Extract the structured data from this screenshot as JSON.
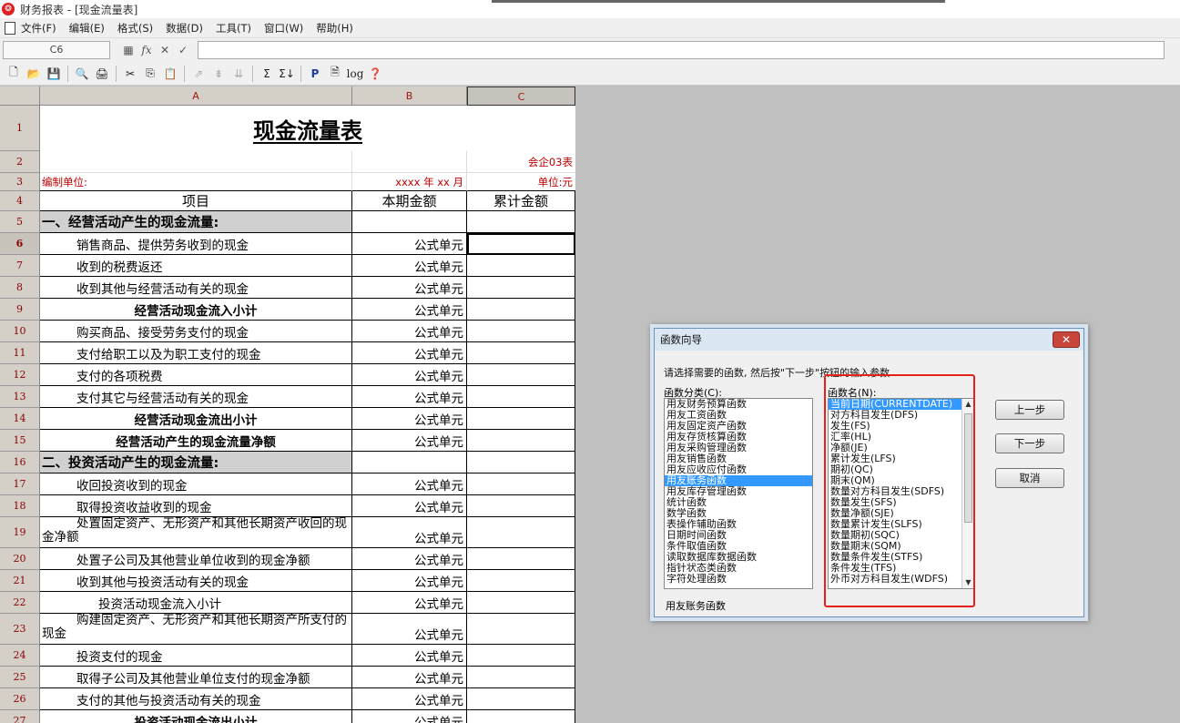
{
  "app": {
    "icon_glyph": "❂",
    "title": "财务报表 - [现金流量表]"
  },
  "menu": [
    "文件(F)",
    "编辑(E)",
    "格式(S)",
    "数据(D)",
    "工具(T)",
    "窗口(W)",
    "帮助(H)"
  ],
  "formula_bar": {
    "cell_ref": "C6",
    "icons": {
      "calc": "▦",
      "fx": "fx",
      "cancel": "✕",
      "confirm": "✓"
    },
    "value": ""
  },
  "toolbar": {
    "icons": {
      "new": "🗋",
      "open": "📂",
      "save": "💾",
      "preview": "🔍",
      "print": "🖨",
      "cut": "✂",
      "copy": "⎘",
      "paste": "📋",
      "a1": "⇗",
      "a2": "⇟",
      "a3": "⇊",
      "sum": "Σ",
      "sum2": "Σ↓",
      "p": "P",
      "doc": "🗎",
      "log": "log",
      "help": "❓"
    }
  },
  "columns": [
    "A",
    "B",
    "C"
  ],
  "sheet": {
    "title": "现金流量表",
    "form_code": "会企03表",
    "unit_label": "编制单位:",
    "period": "xxxx 年 xx 月",
    "currency": "单位:元",
    "headers": {
      "item": "项目",
      "current": "本期金额",
      "cumulative": "累计金额"
    },
    "formula_cell": "公式单元",
    "rows": [
      {
        "n": "5",
        "text": "一、经营活动产生的现金流量:",
        "style": "section",
        "formula": false
      },
      {
        "n": "6",
        "text": "销售商品、提供劳务收到的现金",
        "style": "indent",
        "formula": true
      },
      {
        "n": "7",
        "text": "收到的税费返还",
        "style": "indent",
        "formula": true
      },
      {
        "n": "8",
        "text": "收到其他与经营活动有关的现金",
        "style": "indent",
        "formula": true
      },
      {
        "n": "9",
        "text": "经营活动现金流入小计",
        "style": "bold",
        "formula": true
      },
      {
        "n": "10",
        "text": "购买商品、接受劳务支付的现金",
        "style": "indent",
        "formula": true
      },
      {
        "n": "11",
        "text": "支付给职工以及为职工支付的现金",
        "style": "indent",
        "formula": true
      },
      {
        "n": "12",
        "text": "支付的各项税费",
        "style": "indent",
        "formula": true
      },
      {
        "n": "13",
        "text": "支付其它与经营活动有关的现金",
        "style": "indent",
        "formula": true
      },
      {
        "n": "14",
        "text": "经营活动现金流出小计",
        "style": "bold",
        "formula": true
      },
      {
        "n": "15",
        "text": "经营活动产生的现金流量净额",
        "style": "bold",
        "formula": true
      },
      {
        "n": "16",
        "text": "二、投资活动产生的现金流量:",
        "style": "section",
        "formula": false
      },
      {
        "n": "17",
        "text": "收回投资收到的现金",
        "style": "indent",
        "formula": true
      },
      {
        "n": "18",
        "text": "取得投资收益收到的现金",
        "style": "indent",
        "formula": true
      },
      {
        "n": "19",
        "text": "处置固定资产、无形资产和其他长期资产收回的现金净额",
        "style": "wrap",
        "formula": true
      },
      {
        "n": "20",
        "text": "处置子公司及其他营业单位收到的现金净额",
        "style": "indent",
        "formula": true
      },
      {
        "n": "21",
        "text": "收到其他与投资活动有关的现金",
        "style": "indent",
        "formula": true
      },
      {
        "n": "22",
        "text": "投资活动现金流入小计",
        "style": "subindent",
        "formula": true
      },
      {
        "n": "23",
        "text": "购建固定资产、无形资产和其他长期资产所支付的现金",
        "style": "wrap",
        "formula": true
      },
      {
        "n": "24",
        "text": "投资支付的现金",
        "style": "indent",
        "formula": true
      },
      {
        "n": "25",
        "text": "取得子公司及其他营业单位支付的现金净额",
        "style": "indent",
        "formula": true
      },
      {
        "n": "26",
        "text": "支付的其他与投资活动有关的现金",
        "style": "indent",
        "formula": true
      },
      {
        "n": "27",
        "text": "投资活动现金流出小计",
        "style": "bold",
        "formula": true
      }
    ]
  },
  "dialog": {
    "title": "函数向导",
    "close_glyph": "✕",
    "instruction": "请选择需要的函数, 然后按\"下一步\"按钮的输入参数",
    "category_label": "函数分类(C):",
    "function_label": "函数名(N):",
    "categories": [
      "用友财务预算函数",
      "用友工资函数",
      "用友固定资产函数",
      "用友存货核算函数",
      "用友采购管理函数",
      "用友销售函数",
      "用友应收应付函数",
      "用友账务函数",
      "用友库存管理函数",
      "统计函数",
      "数学函数",
      "表操作辅助函数",
      "日期时间函数",
      "条件取值函数",
      "读取数据库数据函数",
      "指针状态类函数",
      "字符处理函数"
    ],
    "selected_category": "用友账务函数",
    "functions": [
      "当前日期(CURRENTDATE)",
      "对方科目发生(DFS)",
      "发生(FS)",
      "汇率(HL)",
      "净额(JE)",
      "累计发生(LFS)",
      "期初(QC)",
      "期末(QM)",
      "数量对方科目发生(SDFS)",
      "数量发生(SFS)",
      "数量净额(SJE)",
      "数量累计发生(SLFS)",
      "数量期初(SQC)",
      "数量期末(SQM)",
      "数量条件发生(STFS)",
      "条件发生(TFS)",
      "外币对方科目发生(WDFS)"
    ],
    "selected_function": "当前日期(CURRENTDATE)",
    "buttons": {
      "prev": "上一步",
      "next": "下一步",
      "cancel": "取消"
    },
    "status": "用友账务函数",
    "scroll": {
      "up": "▲",
      "down": "▼"
    }
  }
}
